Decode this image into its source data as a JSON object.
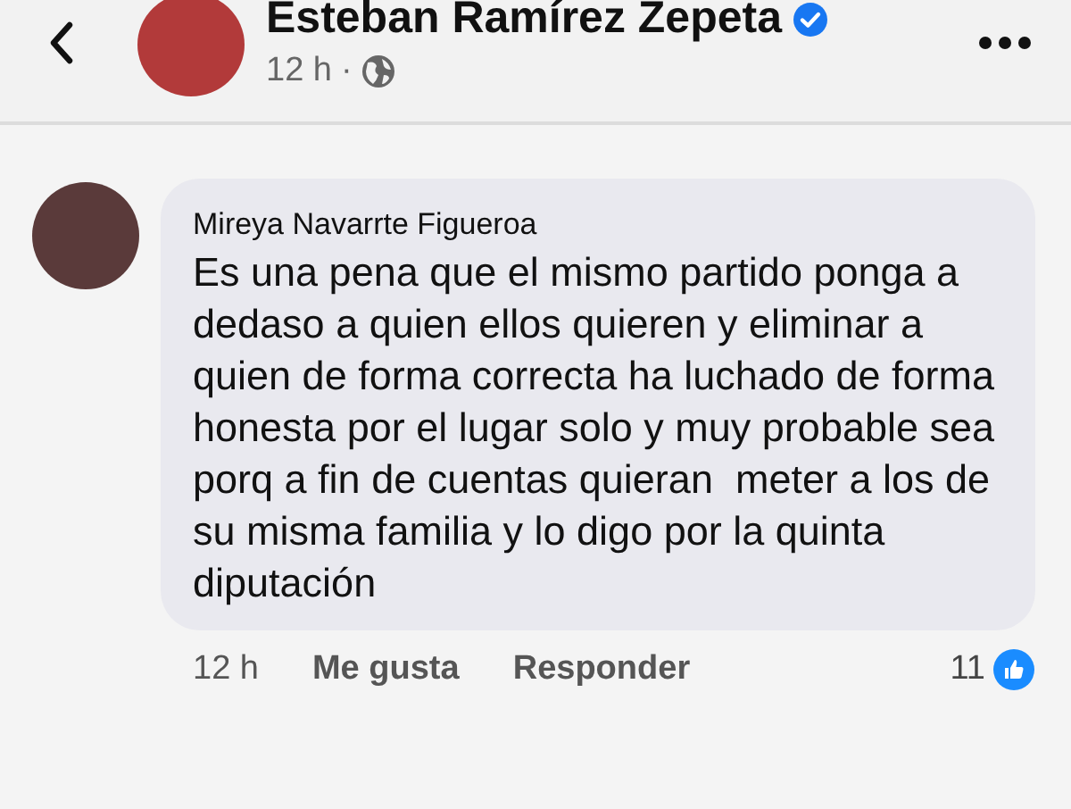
{
  "header": {
    "name": "Esteban Ramírez Zepeta",
    "verified": true,
    "time": "12 h",
    "separator": "·"
  },
  "comment": {
    "author": "Mireya Navarrte Figueroa",
    "text": "Es una pena que el mismo partido ponga a dedaso a quien ellos quieren y eliminar a quien de forma correcta ha luchado de forma honesta por el lugar solo y muy probable sea porq a fin de cuentas quieran  meter a los de su misma familia y lo digo por la quinta diputación",
    "time": "12 h",
    "actions": [
      "Me gusta",
      "Responder"
    ],
    "likes": "11"
  }
}
